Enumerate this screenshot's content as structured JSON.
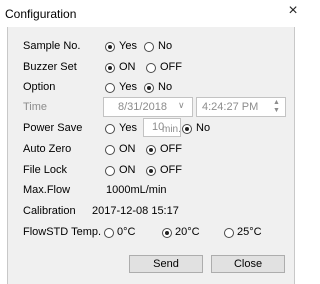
{
  "window": {
    "title": "Configuration",
    "close_glyph": "×"
  },
  "rows": {
    "sample_no": {
      "label": "Sample No.",
      "yes": "Yes",
      "no": "No"
    },
    "buzzer_set": {
      "label": "Buzzer Set",
      "on": "ON",
      "off": "OFF"
    },
    "option": {
      "label": "Option",
      "yes": "Yes",
      "no": "No"
    },
    "time": {
      "label": "Time",
      "date": "8/31/2018",
      "time": "4:24:27 PM"
    },
    "power_save": {
      "label": "Power Save",
      "yes": "Yes",
      "minutes": "10",
      "unit": "min.",
      "no": "No"
    },
    "auto_zero": {
      "label": "Auto Zero",
      "on": "ON",
      "off": "OFF"
    },
    "file_lock": {
      "label": "File Lock",
      "on": "ON",
      "off": "OFF"
    },
    "max_flow": {
      "label": "Max.Flow",
      "value": "1000mL/min"
    },
    "calibration": {
      "label": "Calibration",
      "value": "2017-12-08 15:17"
    },
    "flowstd_temp": {
      "label": "FlowSTD Temp.",
      "opt1": "0°C",
      "opt2": "20°C",
      "opt3": "25°C"
    }
  },
  "buttons": {
    "send": "Send",
    "close": "Close"
  }
}
